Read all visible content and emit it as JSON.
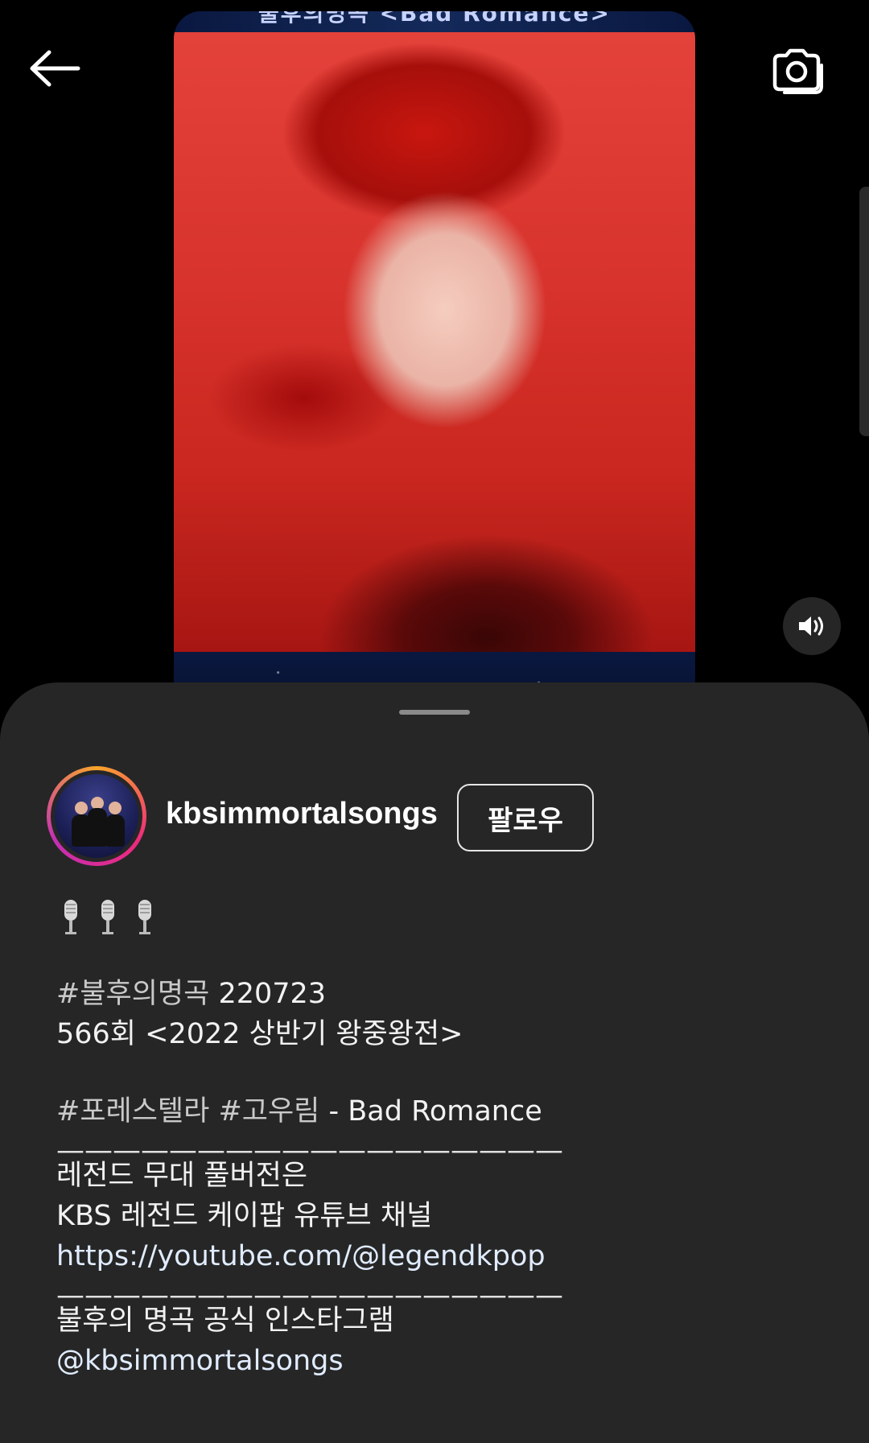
{
  "header": {
    "back_icon": "arrow-left-icon",
    "camera_icon": "camera-icon"
  },
  "video": {
    "banner_top_text": "불후의명곡 <Bad Romance>",
    "volume_icon": "volume-on-icon"
  },
  "post": {
    "username": "kbsimmortalsongs",
    "follow_label": "팔로우",
    "caption": {
      "mics": "🎙️🎙️🎙️",
      "line1_hashtag": "#불후의명곡",
      "line1_rest": " 220723",
      "line2": "566회 <2022 상반기 왕중왕전>",
      "line3_hashtags": "#포레스텔라 #고우림",
      "line3_rest": " - Bad Romance",
      "divider": "——————————————————",
      "line4": "레전드 무대 풀버전은",
      "line5": "KBS 레전드 케이팝 유튜브 채널",
      "line6_prefix": "https://youtube.com/",
      "line6_link": "@legendkpop",
      "line7": "불후의 명곡 공식 인스타그램",
      "line8_link": "@kbsimmortalsongs"
    }
  }
}
